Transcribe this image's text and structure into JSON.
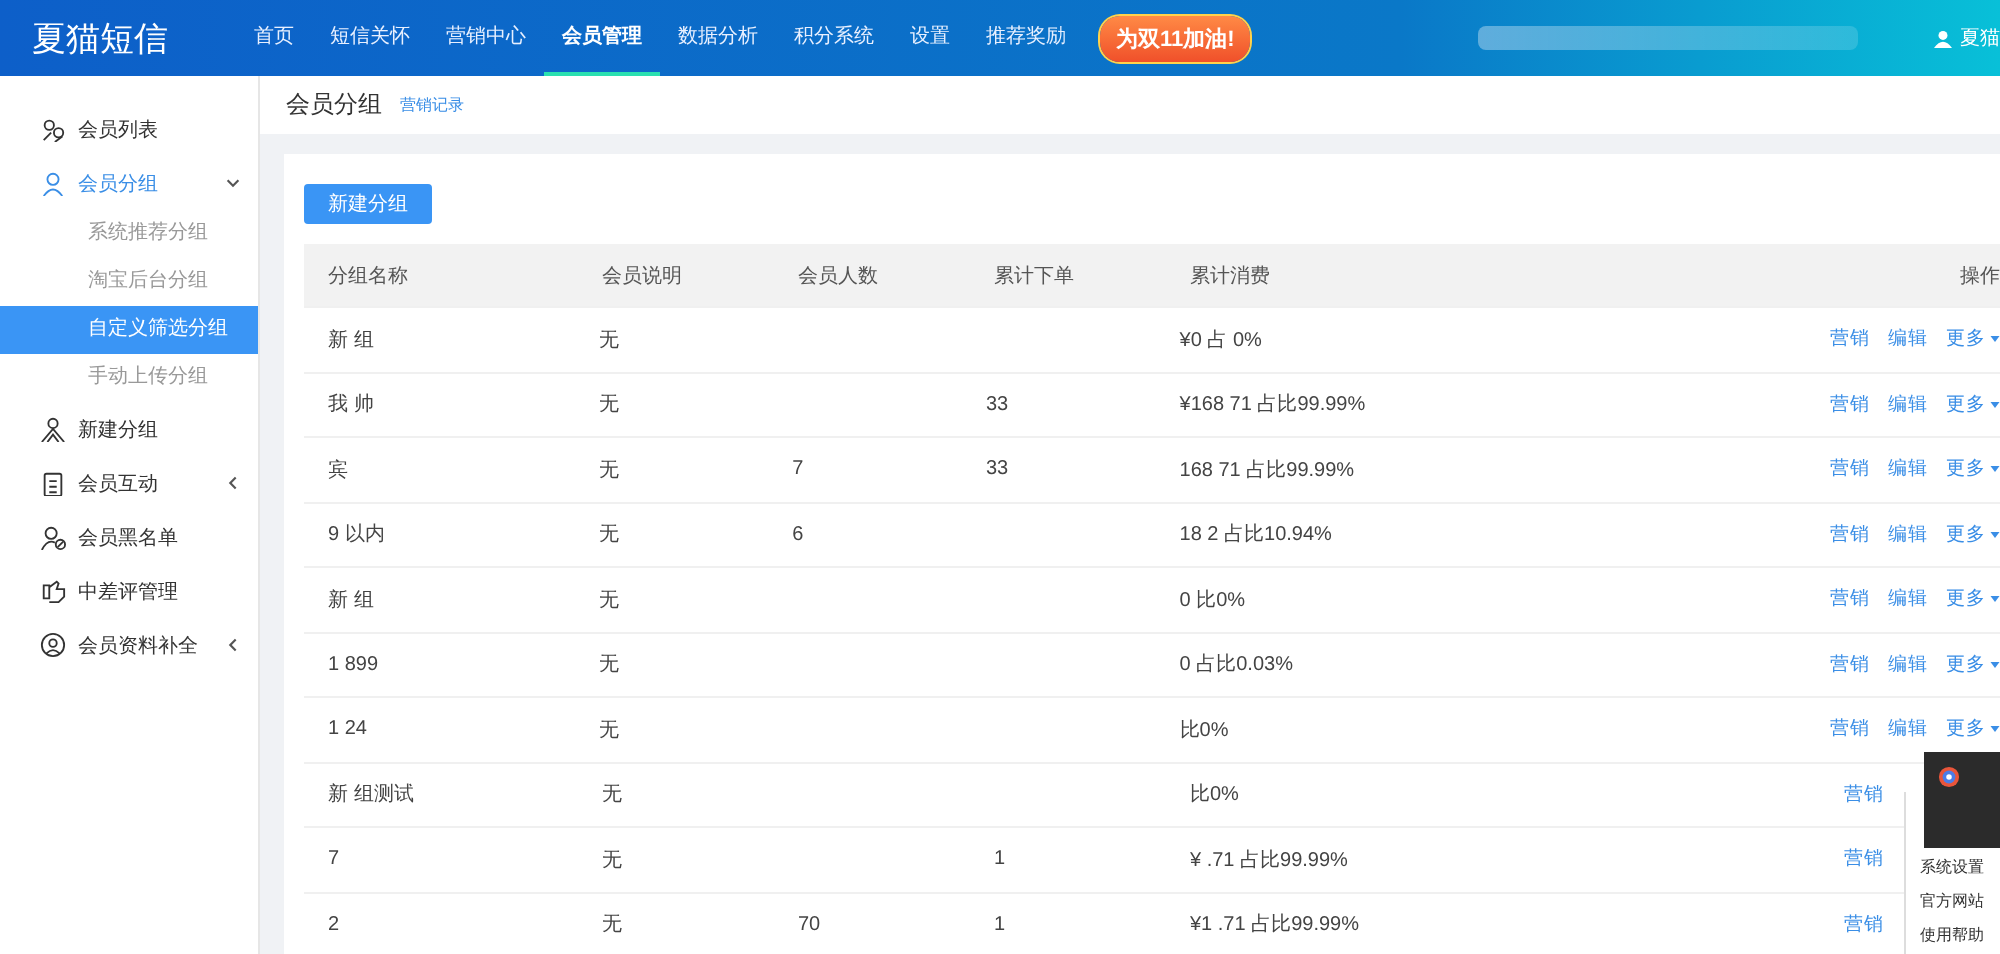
{
  "header": {
    "logo": "夏猫短信",
    "nav": [
      {
        "label": "首页",
        "selected": false
      },
      {
        "label": "短信关怀",
        "selected": false
      },
      {
        "label": "营销中心",
        "selected": false
      },
      {
        "label": "会员管理",
        "selected": true
      },
      {
        "label": "数据分析",
        "selected": false
      },
      {
        "label": "积分系统",
        "selected": false
      },
      {
        "label": "设置",
        "selected": false
      },
      {
        "label": "推荐奖励",
        "selected": false
      }
    ],
    "promo": "为双11加油!",
    "user": "夏猫"
  },
  "sidebar": {
    "items": [
      {
        "label": "会员列表",
        "selected": false
      },
      {
        "label": "会员分组",
        "selected": true,
        "expanded": true,
        "children": [
          {
            "label": "系统推荐分组",
            "selected": false
          },
          {
            "label": "淘宝后台分组",
            "selected": false
          },
          {
            "label": "自定义筛选分组",
            "selected": true
          },
          {
            "label": "手动上传分组",
            "selected": false
          }
        ]
      },
      {
        "label": "新建分组",
        "selected": false
      },
      {
        "label": "会员互动",
        "selected": false,
        "expanded": false
      },
      {
        "label": "会员黑名单",
        "selected": false
      },
      {
        "label": "中差评管理",
        "selected": false
      },
      {
        "label": "会员资料补全",
        "selected": false,
        "expanded": false
      }
    ]
  },
  "page": {
    "title": "会员分组",
    "link": "营销记录",
    "new_button": "新建分组"
  },
  "table": {
    "columns": [
      "分组名称",
      "会员说明",
      "会员人数",
      "累计下单",
      "累计消费",
      "操作"
    ],
    "rows": [
      {
        "cells": [
          "新 组",
          "无",
          "",
          "",
          "¥0 占 0%"
        ],
        "actions": [
          "营销",
          "编辑",
          "更多"
        ]
      },
      {
        "cells": [
          "我 帅",
          "无",
          "",
          "33",
          "¥168 71 占比99.99%"
        ],
        "actions": [
          "营销",
          "编辑",
          "更多"
        ]
      },
      {
        "cells": [
          "宾",
          "无",
          "7",
          "33",
          "168 71 占比99.99%"
        ],
        "actions": [
          "营销",
          "编辑",
          "更多"
        ]
      },
      {
        "cells": [
          "9 以内",
          "无",
          "6",
          "",
          "18 2 占比10.94%"
        ],
        "actions": [
          "营销",
          "编辑",
          "更多"
        ]
      },
      {
        "cells": [
          "新 组",
          "无",
          "",
          "",
          "0 比0%"
        ],
        "actions": [
          "营销",
          "编辑",
          "更多"
        ]
      },
      {
        "cells": [
          "1 899",
          "无",
          "",
          "",
          "0 占比0.03%"
        ],
        "actions": [
          "营销",
          "编辑",
          "更多"
        ]
      },
      {
        "cells": [
          "1 24",
          "无",
          "",
          "",
          "比0%"
        ],
        "actions": [
          "营销",
          "编辑",
          "更多"
        ]
      },
      {
        "cells": [
          "新 组测试",
          "无",
          "",
          "",
          "比0%"
        ],
        "actions": [
          "营销"
        ]
      },
      {
        "cells": [
          "7",
          "无",
          "",
          "1",
          "¥ .71 占比99.99%"
        ],
        "actions": [
          "营销"
        ]
      },
      {
        "cells": [
          "2",
          "无",
          "70",
          "1",
          "¥1 .71 占比99.99%"
        ],
        "actions": [
          "营销"
        ]
      }
    ]
  },
  "popup": {
    "items": [
      "系统设置",
      "官方网站",
      "使用帮助"
    ]
  }
}
